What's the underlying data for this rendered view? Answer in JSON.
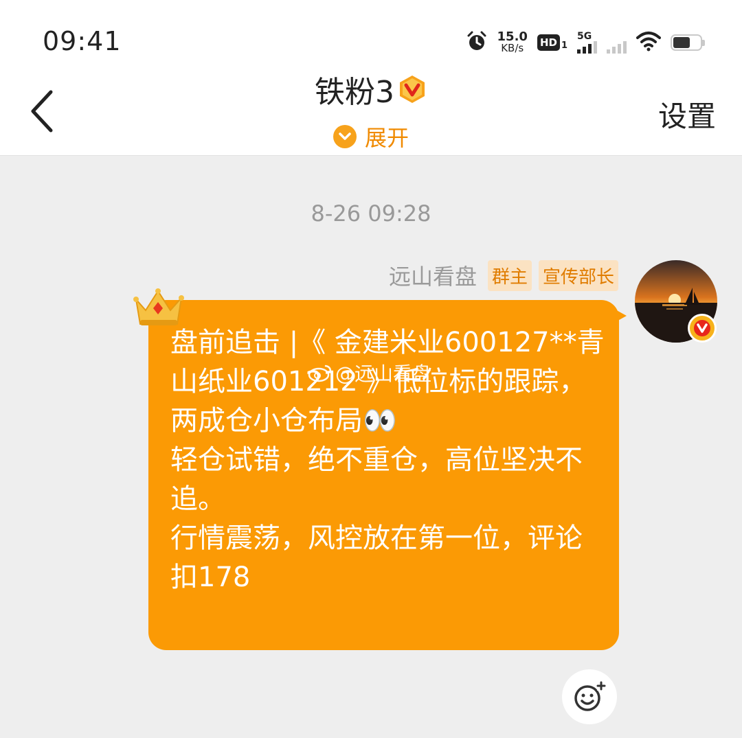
{
  "status_bar": {
    "time": "09:41",
    "net_speed_value": "15.0",
    "net_speed_unit": "KB/s",
    "hd_label": "HD",
    "hd_sub": "1",
    "network_label": "5G",
    "icons": [
      "alarm-icon",
      "hd-icon",
      "signal-5g-icon",
      "signal-icon",
      "wifi-icon",
      "battery-icon"
    ]
  },
  "header": {
    "title": "铁粉3",
    "expand_label": "展开",
    "settings_label": "设置",
    "back_icon": "chevron-left-icon",
    "verified_icon": "verified-v-badge-icon"
  },
  "chat": {
    "timestamp": "8-26 09:28",
    "message": {
      "sender": "远山看盘",
      "tags": [
        "群主",
        "宣传部长"
      ],
      "text": "盘前追击 |《 金建米业600127**青山纸业601212 》低位标的跟踪，两成仓小仓布局👀\n轻仓试错，绝不重仓，高位坚决不追。\n行情震荡，风控放在第一位，评论扣178",
      "watermark": "@远山看盘"
    }
  },
  "colors": {
    "bubble": "#fb9a05",
    "accent": "#f08a00",
    "tag_bg": "#fbe2c2"
  }
}
